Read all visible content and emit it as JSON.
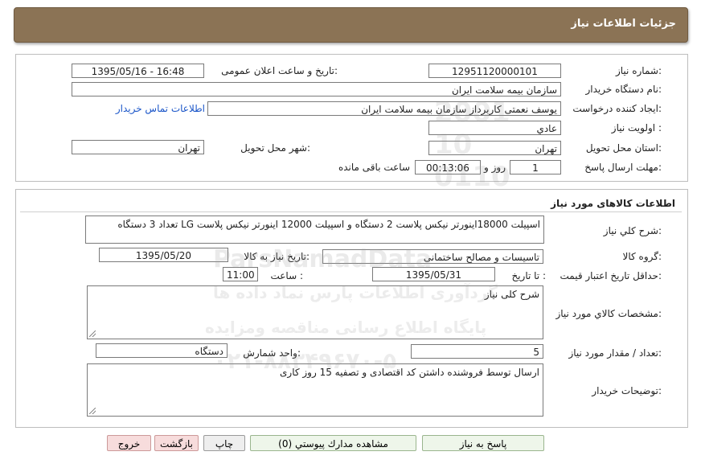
{
  "header": {
    "title": "جزئیات اطلاعات نیاز"
  },
  "general": {
    "need_number_label": "شماره نیاز:",
    "need_number": "12951120000101",
    "announce_label": "تاریخ و ساعت اعلان عمومی:",
    "announce_value": "1395/05/16 - 16:48",
    "buyer_org_label": "نام دستگاه خریدار:",
    "buyer_org": "سازمان بیمه سلامت ایران",
    "requester_label": "ایجاد کننده درخواست:",
    "requester": "یوسف نعمتی کاربرداز سازمان بیمه سلامت ایران",
    "contact_link": "اطلاعات تماس خریدار",
    "priority_label": "اولویت نیاز :",
    "priority": "عادي",
    "province_label": "استان محل تحویل:",
    "province": "تهران",
    "city_label": "شهر محل تحویل:",
    "city": "تهران",
    "deadline_label": "مهلت ارسال پاسخ:",
    "days": "1",
    "days_suffix": "روز و",
    "time": "00:13:06",
    "time_suffix": "ساعت باقی مانده"
  },
  "goods": {
    "section_title": "اطلاعات کالاهای مورد نیاز",
    "summary_label": "شرح کلي نیاز:",
    "summary": "اسپیلت 18000اینورتر نیکس پلاست 2 دستگاه و اسپیلت 12000 اینورتر نیکس پلاست LG تعداد 3 دستگاه",
    "group_label": "گروه کالا:",
    "group": "تاسیسات و مصالح ساختمانی",
    "need_date_label": "تاریخ نیاز به کالا:",
    "need_date": "1395/05/20",
    "validity_label": "حداقل تاریخ اعتبار قیمت:",
    "until_date_label": "تا تاریخ :",
    "until_date": "1395/05/31",
    "hour_label": "ساعت :",
    "hour": "11:00",
    "specs_label": "مشخصات کالاي مورد نیاز:",
    "specs": "شرح کلی نیاز",
    "qty_label": "تعداد / مقدار مورد نیاز:",
    "qty": "5",
    "unit_label": "واحد شمارش:",
    "unit": "دستگاه",
    "buyer_notes_label": "توضیحات خریدار:",
    "buyer_notes": "ارسال توسط فروشنده داشتن کد اقتصادی و تصفیه 15 روز کاری"
  },
  "buttons": {
    "reply": "پاسخ به نیاز",
    "attachments": "مشاهده مدارك پیوستي (0)",
    "print": "چاپ",
    "back": "بازگشت",
    "exit": "خروج"
  },
  "watermark": {
    "brand": "ParsNamadData",
    "line1": "گردآوری اطلاعات پارس نماد داده ها",
    "line2": "پایگاه اطلاع رسانی مناقصه ومزایده",
    "line3": "۰۲۱-۸۸۳۴۹۶۷۰-۵"
  },
  "colors": {
    "header_bg": "#8b7355",
    "link": "#1a55c8"
  }
}
